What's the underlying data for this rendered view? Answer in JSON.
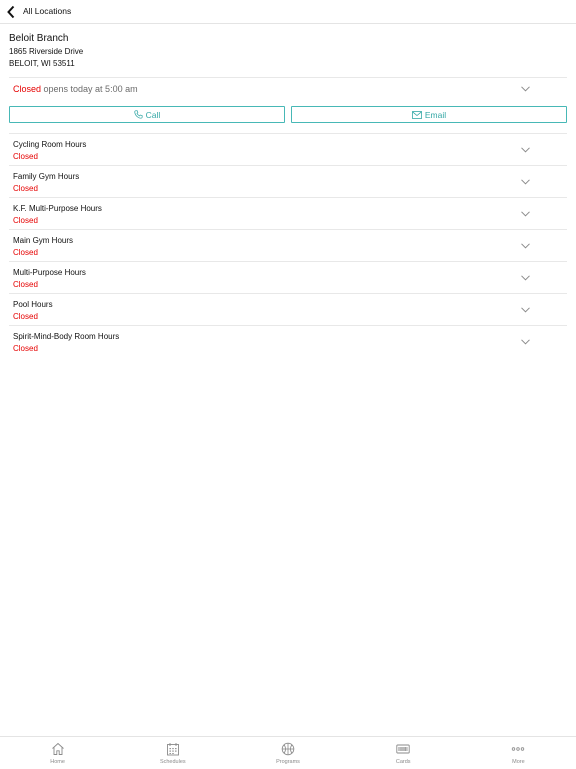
{
  "header": {
    "back_label": "All Locations"
  },
  "branch": {
    "name": "Beloit Branch",
    "address_line1": "1865 Riverside Drive",
    "address_line2": "BELOIT, WI 53511"
  },
  "status": {
    "state": "Closed",
    "detail": " opens today at 5:00 am"
  },
  "actions": {
    "call_label": "Call",
    "email_label": "Email"
  },
  "facilities": [
    {
      "name": "Cycling Room Hours",
      "status": "Closed"
    },
    {
      "name": "Family Gym Hours",
      "status": "Closed"
    },
    {
      "name": "K.F. Multi-Purpose Hours",
      "status": "Closed"
    },
    {
      "name": "Main Gym Hours",
      "status": "Closed"
    },
    {
      "name": "Multi-Purpose Hours",
      "status": "Closed"
    },
    {
      "name": "Pool Hours",
      "status": "Closed"
    },
    {
      "name": "Spirit-Mind-Body Room Hours",
      "status": "Closed"
    }
  ],
  "tabs": [
    {
      "label": "Home",
      "icon": "home-icon"
    },
    {
      "label": "Schedules",
      "icon": "calendar-icon"
    },
    {
      "label": "Programs",
      "icon": "basketball-icon"
    },
    {
      "label": "Cards",
      "icon": "card-icon"
    },
    {
      "label": "More",
      "icon": "more-icon"
    }
  ],
  "colors": {
    "accent": "#35a8a6",
    "closed": "#e60000"
  }
}
